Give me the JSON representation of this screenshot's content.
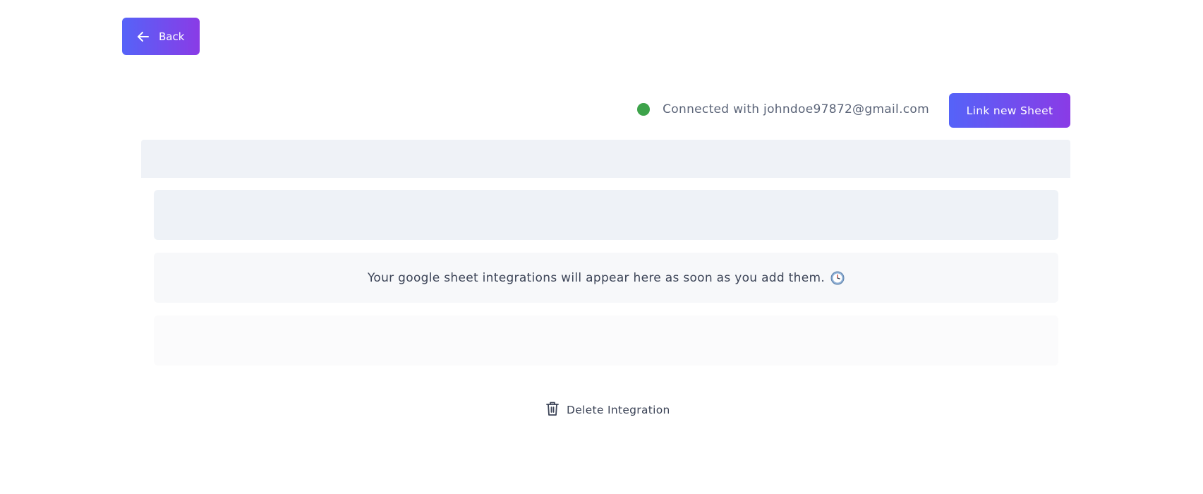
{
  "back_button": {
    "label": "Back"
  },
  "connection": {
    "status_text": "Connected with johndoe97872@gmail.com",
    "status_color": "#3da34a"
  },
  "link_button": {
    "label": "Link new Sheet"
  },
  "empty_state": {
    "message": "Your google sheet integrations will appear here as soon as you add them."
  },
  "delete_integration": {
    "label": "Delete Integration"
  },
  "colors": {
    "accent_start": "#5563f8",
    "accent_end": "#8a3be6"
  }
}
